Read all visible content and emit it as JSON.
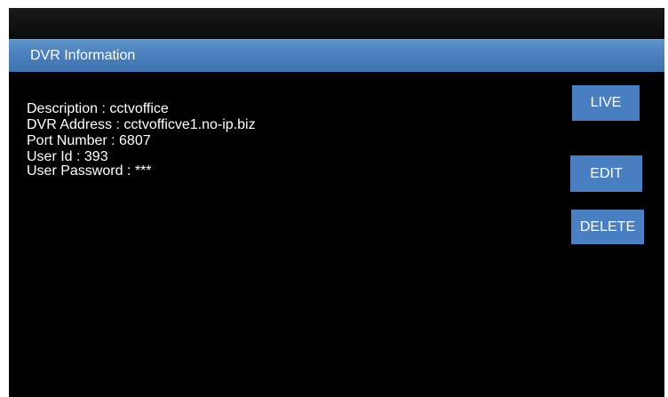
{
  "window": {
    "title": "DVR Information"
  },
  "details": {
    "description": "Description : cctvoffice",
    "dvr_address": "DVR Address : cctvofficve1.no-ip.biz",
    "port_number": "Port Number : 6807",
    "user_id": "User Id : 393",
    "user_password": "User Password : ***"
  },
  "actions": {
    "live_label": "LIVE",
    "edit_label": "EDIT",
    "delete_label": "DELETE"
  },
  "colors": {
    "title_bar": "#4b80bd",
    "button": "#4a7fc1",
    "background": "#000000",
    "text": "#ffffff"
  }
}
